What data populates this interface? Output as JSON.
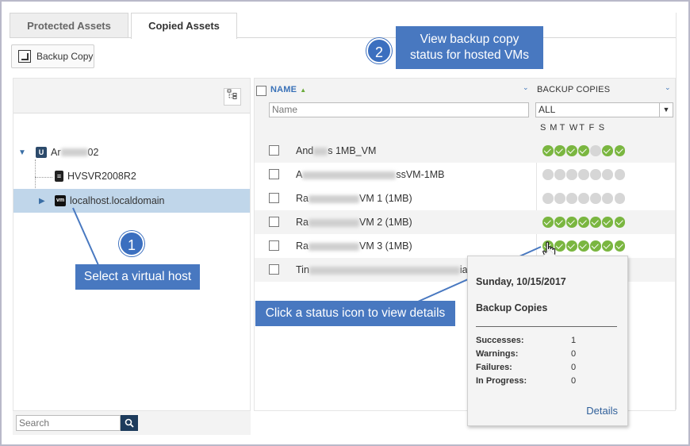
{
  "tabs": [
    {
      "label": "Protected Assets",
      "active": false
    },
    {
      "label": "Copied Assets",
      "active": true
    }
  ],
  "toolbar": {
    "backup_copy_label": "Backup Copy"
  },
  "tree": {
    "root_label": "Ar",
    "root_label_tail": "02",
    "children": [
      {
        "label": "HVSVR2008R2"
      },
      {
        "label": "localhost.localdomain",
        "selected": true
      }
    ]
  },
  "left_search": {
    "placeholder": "Search"
  },
  "grid": {
    "col_name": "NAME",
    "col_backup": "BACKUP COPIES",
    "name_filter_placeholder": "Name",
    "backup_filter_value": "ALL",
    "days": [
      "S",
      "M",
      "T",
      "W",
      "T",
      "F",
      "S"
    ],
    "rows": [
      {
        "prefix": "And",
        "suffix": "s 1MB_VM",
        "status": [
          "ok",
          "ok",
          "ok",
          "ok",
          "none",
          "ok",
          "ok"
        ]
      },
      {
        "prefix": "A",
        "suffix": "ssVM-1MB",
        "status": [
          "none",
          "none",
          "none",
          "none",
          "none",
          "none",
          "none"
        ]
      },
      {
        "prefix": "Ra",
        "suffix": "VM 1 (1MB)",
        "status": [
          "none",
          "none",
          "none",
          "none",
          "none",
          "none",
          "none"
        ]
      },
      {
        "prefix": "Ra",
        "suffix": "VM 2 (1MB)",
        "status": [
          "ok",
          "ok",
          "ok",
          "ok",
          "ok",
          "ok",
          "ok"
        ]
      },
      {
        "prefix": "Ra",
        "suffix": "VM 3 (1MB)",
        "status": [
          "ok",
          "ok",
          "ok",
          "ok",
          "ok",
          "ok",
          "ok"
        ]
      },
      {
        "prefix": "Tin",
        "suffix": "ia",
        "status": []
      }
    ]
  },
  "callouts": {
    "one_number": "1",
    "one_text": "Select a virtual host",
    "two_number": "2",
    "two_text_line1": "View backup copy",
    "two_text_line2": "status for hosted VMs",
    "three_text": "Click a status icon to view details"
  },
  "popup": {
    "date": "Sunday, 10/15/2017",
    "title": "Backup Copies",
    "rows": [
      {
        "label": "Successes:",
        "value": "1"
      },
      {
        "label": "Warnings:",
        "value": "0"
      },
      {
        "label": "Failures:",
        "value": "0"
      },
      {
        "label": "In Progress:",
        "value": "0"
      }
    ],
    "details_label": "Details"
  },
  "colors": {
    "accent": "#4878c0",
    "success": "#7ab640",
    "selected_row": "#c0d6ea"
  }
}
